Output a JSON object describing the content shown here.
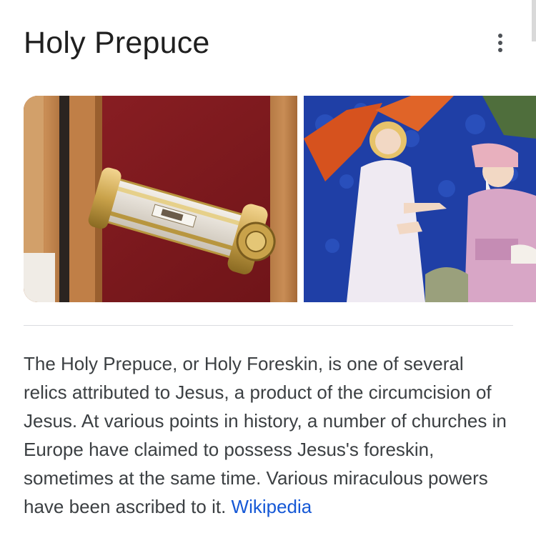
{
  "panel": {
    "title": "Holy Prepuce",
    "menu_icon": "more-vert-icon"
  },
  "images": [
    {
      "subject": "reliquary",
      "icon": "image-thumbnail"
    },
    {
      "subject": "illuminated-manuscript",
      "icon": "image-thumbnail"
    }
  ],
  "description": {
    "text": "The Holy Prepuce, or Holy Foreskin, is one of several relics attributed to Jesus, a product of the circumcision of Jesus. At various points in history, a number of churches in Europe have claimed to possess Jesus's foreskin, sometimes at the same time. Various miraculous powers have been ascribed to it.",
    "source_label": "Wikipedia"
  },
  "colors": {
    "link": "#1558d6",
    "text": "#3c4043",
    "title": "#1f1f1f",
    "divider": "#dadce0"
  }
}
